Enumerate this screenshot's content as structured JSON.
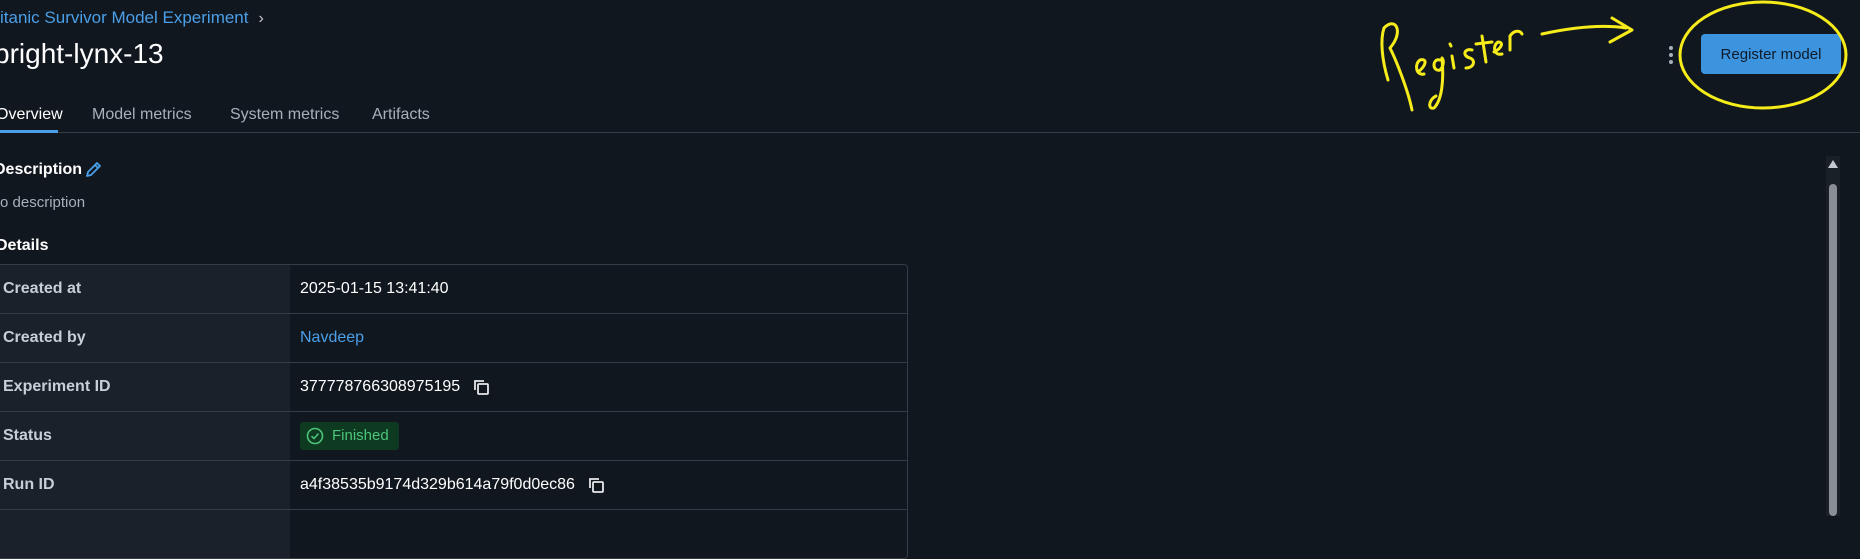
{
  "breadcrumb": {
    "experiment": "itanic Survivor Model Experiment",
    "separator": "›"
  },
  "run_title": "bright-lynx-13",
  "actions": {
    "register_label": "Register model"
  },
  "tabs": [
    {
      "label": "Overview",
      "active": true
    },
    {
      "label": "Model metrics",
      "active": false
    },
    {
      "label": "System metrics",
      "active": false
    },
    {
      "label": "Artifacts",
      "active": false
    }
  ],
  "description": {
    "heading": "Description",
    "text": "o description"
  },
  "details": {
    "heading": "Details",
    "rows": [
      {
        "key": "Created at",
        "value": "2025-01-15 13:41:40"
      },
      {
        "key": "Created by",
        "value": "Navdeep"
      },
      {
        "key": "Experiment ID",
        "value": "377778766308975195"
      },
      {
        "key": "Status",
        "value": "Finished"
      },
      {
        "key": "Run ID",
        "value": "a4f38535b9174d329b614a79f0d0ec86"
      }
    ]
  },
  "annotation": {
    "text": "Register",
    "color": "#f5ec1a"
  },
  "colors": {
    "accent": "#4a9fe8",
    "background": "#11171f",
    "success": "#4cc47a"
  }
}
